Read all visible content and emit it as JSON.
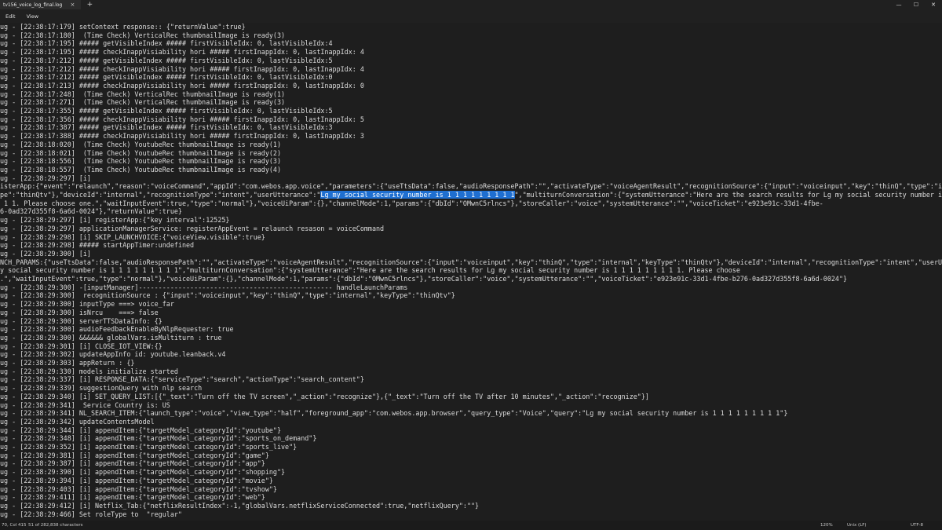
{
  "window": {
    "tab_title": "tv156_voice_log_final.log",
    "close_glyph": "×",
    "new_tab_glyph": "+",
    "minimize_glyph": "—",
    "maximize_glyph": "☐",
    "close_window_glyph": "✕"
  },
  "menu": {
    "items": [
      "Edit",
      "View"
    ]
  },
  "editor": {
    "selected_text": "Lg my social security number is 1 1 1 1 1 1 1 1 1",
    "selection_color": "#1f6fd1",
    "lines": [
      "ug - [22:38:17:179] setContext response:: {\"returnValue\":true}",
      "ug - [22:38:17:180]  (Time Check) VerticalRec thumbnailImage is ready(3)",
      "ug - [22:38:17:195] ##### getVisibleIndex ##### firstVisibleIdx: 0, lastVisibleIdx:4",
      "ug - [22:38:17:195] ##### checkInappVisiability hori ##### firstInappIdx: 0, lastInappIdx: 4",
      "ug - [22:38:17:212] ##### getVisibleIndex ##### firstVisibleIdx: 0, lastVisibleIdx:5",
      "ug - [22:38:17:212] ##### checkInappVisiability hori ##### firstInappIdx: 0, lastInappIdx: 4",
      "ug - [22:38:17:212] ##### getVisibleIndex ##### firstVisibleIdx: 0, lastVisibleIdx:0",
      "ug - [22:38:17:213] ##### checkInappVisiability hori ##### firstInappIdx: 0, lastInappIdx: 0",
      "ug - [22:38:17:248]  (Time Check) VerticalRec thumbnailImage is ready(1)",
      "ug - [22:38:17:271]  (Time Check) VerticalRec thumbnailImage is ready(3)",
      "ug - [22:38:17:355] ##### getVisibleIndex ##### firstVisibleIdx: 0, lastVisibleIdx:5",
      "ug - [22:38:17:356] ##### checkInappVisiability hori ##### firstInappIdx: 0, lastInappIdx: 5",
      "ug - [22:38:17:387] ##### getVisibleIndex ##### firstVisibleIdx: 0, lastVisibleIdx:3",
      "ug - [22:38:17:388] ##### checkInappVisiability hori ##### firstInappIdx: 0, lastInappIdx: 3",
      "ug - [22:38:18:020]  (Time Check) YoutubeRec thumbnailImage is ready(1)",
      "ug - [22:38:18:021]  (Time Check) YoutubeRec thumbnailImage is ready(2)",
      "ug - [22:38:18:556]  (Time Check) YoutubeRec thumbnailImage is ready(3)",
      "ug - [22:38:18:557]  (Time Check) YoutubeRec thumbnailImage is ready(4)",
      "ug - [22:38:29:297] [i]",
      "isterApp:{\"event\":\"relaunch\",\"reason\":\"voiceCommand\",\"appId\":\"com.webos.app.voice\",\"parameters\":{\"useTtsData\":false,\"audioResponsePath\":\"\",\"activateType\":\"voiceAgentResult\",\"recognitionSource\":{\"input\":\"voiceinput\",\"key\":\"thinQ\",\"type\":\"internal\",",
      "pe\":\"thinQtv\"},\"deviceId\":\"internal\",\"recognitionType\":\"intent\",\"userUtterance\":\"Lg my social security number is 1 1 1 1 1 1 1 1 1\",\"multiturnConversation\":{\"systemUtterance\":\"Here are the search results for Lg my social security number is 1 1 1 1",
      " 1 1. Please choose one.\",\"waitInputEvent\":true,\"type\":\"normal\"},\"voiceUiParam\":{},\"channelMode\":1,\"params\":{\"dbId\":\"OMwnC5rlncs\"},\"storeCaller\":\"voice\",\"systemUtterance\":\"\",\"voiceTicket\":\"e923e91c-33d1-4fbe-",
      "6-0ad327d355f8-6a6d-0024\"},\"returnValue\":true}",
      "ug - [22:38:29:297] [i] registerApp:{\"key interval\":12525}",
      "ug - [22:38:29:297] applicationManagerService: registerAppEvent = relaunch resason = voiceCommand",
      "ug - [22:38:29:298] [i] SKIP_LAUNCHVOICE:{\"voiceView.visible\":true}",
      "ug - [22:38:29:298] ##### startAppTimer:undefined",
      "ug - [22:38:29:300] [i]",
      "NCH_PARAMS:{\"useTtsData\":false,\"audioResponsePath\":\"\",\"activateType\":\"voiceAgentResult\",\"recognitionSource\":{\"input\":\"voiceinput\",\"key\":\"thinQ\",\"type\":\"internal\",\"keyType\":\"thinQtv\"},\"deviceId\":\"internal\",\"recognitionType\":\"intent\",\"userUtterance\"",
      "y social security number is 1 1 1 1 1 1 1 1 1\",\"multiturnConversation\":{\"systemUtterance\":\"Here are the search results for Lg my social security number is 1 1 1 1 1 1 1 1 1. Please choose",
      ".\",\"waitInputEvent\":true,\"type\":\"normal\"},\"voiceUiParam\":{},\"channelMode\":1,\"params\":{\"dbId\":\"OMwnC5rlncs\"},\"storeCaller\":\"voice\",\"systemUtterance\":\"\",\"voiceTicket\":\"e923e91c-33d1-4fbe-b276-0ad327d355f8-6a6d-0024\"}",
      "ug - [22:38:29:300] -[inputManager]------------------------------------------------- handleLaunchParams",
      "ug - [22:38:29:300]  recognitionSource : {\"input\":\"voiceinput\",\"key\":\"thinQ\",\"type\":\"internal\",\"keyType\":\"thinQtv\"}",
      "ug - [22:38:29:300] inputType ===> voice_far",
      "ug - [22:38:29:300] isNrcu    ===> false",
      "ug - [22:38:29:300] serverTTSDataInfo: {}",
      "ug - [22:38:29:300] audioFeedbackEnableByNlpRequester: true",
      "ug - [22:38:29:300] &&&&&& globalVars.isMultiturn : true",
      "ug - [22:38:29:301] [i] CLOSE_IOT_VIEW:{}",
      "ug - [22:38:29:302] updateAppInfo id: youtube.leanback.v4",
      "ug - [22:38:29:303] appReturn : {}",
      "ug - [22:38:29:330] models initialize started",
      "ug - [22:38:29:337] [i] RESPONSE_DATA:{\"serviceType\":\"search\",\"actionType\":\"search_content\"}",
      "ug - [22:38:29:339] suggestionQuery with nlp search",
      "ug - [22:38:29:340] [i] SET_QUERY_LIST:[{\"_text\":\"Turn off the TV screen\",\"_action\":\"recognize\"},{\"_text\":\"Turn off the TV after 10 minutes\",\"_action\":\"recognize\"}]",
      "ug - [22:38:29:341]  Service Country is: US",
      "ug - [22:38:29:341] NL_SEARCH_ITEM:{\"launch_type\":\"voice\",\"view_type\":\"half\",\"foreground_app\":\"com.webos.app.browser\",\"query_type\":\"Voice\",\"query\":\"Lg my social security number is 1 1 1 1 1 1 1 1 1\"}",
      "ug - [22:38:29:342] updateContentsModel",
      "ug - [22:38:29:344] [i] appendItem:{\"targetModel_categoryId\":\"youtube\"}",
      "ug - [22:38:29:348] [i] appendItem:{\"targetModel_categoryId\":\"sports_on_demand\"}",
      "ug - [22:38:29:352] [i] appendItem:{\"targetModel_categoryId\":\"sports_live\"}",
      "ug - [22:38:29:381] [i] appendItem:{\"targetModel_categoryId\":\"game\"}",
      "ug - [22:38:29:387] [i] appendItem:{\"targetModel_categoryId\":\"app\"}",
      "ug - [22:38:29:390] [i] appendItem:{\"targetModel_categoryId\":\"shopping\"}",
      "ug - [22:38:29:394] [i] appendItem:{\"targetModel_categoryId\":\"movie\"}",
      "ug - [22:38:29:403] [i] appendItem:{\"targetModel_categoryId\":\"tvshow\"}",
      "ug - [22:38:29:411] [i] appendItem:{\"targetModel_categoryId\":\"web\"}",
      "ug - [22:38:29:412] [i] Netflix_Tab:{\"netflixResultIndex\":-1,\"globalVars.netflixServiceConnected\":true,\"netflixQuery\":\"\"}",
      "ug - [22:38:29:466] Set roleType to  \"regular\""
    ]
  },
  "status": {
    "position": "70, Col 415",
    "selection": "51 of 282,838 characters",
    "zoom": "120%",
    "line_ending": "Unix (LF)",
    "encoding": "UTF-8"
  }
}
